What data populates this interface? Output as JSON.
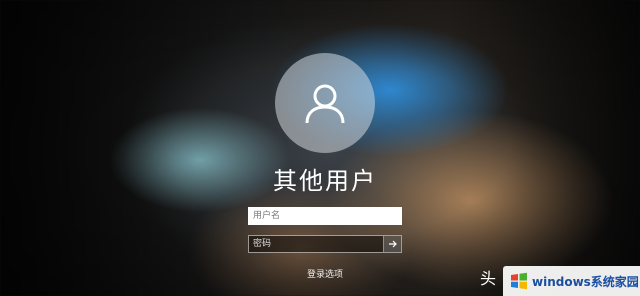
{
  "login": {
    "username": "其他用户",
    "username_placeholder": "用户名",
    "password_placeholder": "密码",
    "signin_options": "登录选项"
  },
  "icons": {
    "avatar": "user-icon",
    "submit": "arrow-right-icon",
    "watermark_logo": "windows-logo-icon"
  },
  "overlay": {
    "corner_glyph": "头",
    "watermark_text": "windows系统家园"
  },
  "colors": {
    "text": "#ffffff",
    "avatar_circle": "#d2d7dc",
    "watermark_text": "#1a4fa0"
  }
}
